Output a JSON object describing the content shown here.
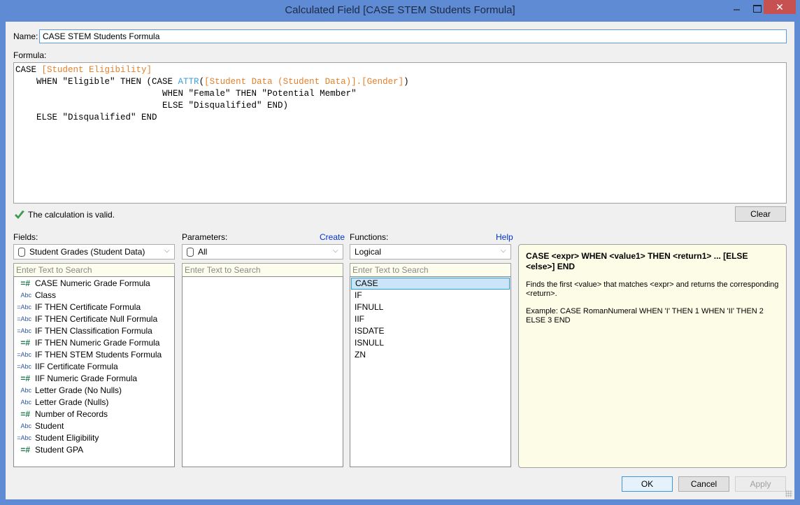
{
  "window": {
    "title": "Calculated Field [CASE STEM Students Formula]",
    "minimize_icon": "minimize-icon",
    "maximize_icon": "maximize-icon",
    "close_icon": "close-icon",
    "close_glyph": "✕"
  },
  "name": {
    "label": "Name:",
    "value": "CASE STEM Students Formula"
  },
  "formula": {
    "label": "Formula:",
    "lines": [
      [
        {
          "t": "kw",
          "v": "CASE "
        },
        {
          "t": "field",
          "v": "[Student Eligibility]"
        }
      ],
      [
        {
          "t": "kw",
          "v": "    WHEN \"Eligible\" THEN (CASE "
        },
        {
          "t": "func",
          "v": "ATTR"
        },
        {
          "t": "kw",
          "v": "("
        },
        {
          "t": "field",
          "v": "[Student Data (Student Data)].[Gender]"
        },
        {
          "t": "kw",
          "v": ")"
        }
      ],
      [
        {
          "t": "kw",
          "v": "                            WHEN \"Female\" THEN \"Potential Member\""
        }
      ],
      [
        {
          "t": "kw",
          "v": "                            ELSE \"Disqualified\" END)"
        }
      ],
      [
        {
          "t": "kw",
          "v": "    ELSE \"Disqualified\" END"
        }
      ]
    ]
  },
  "status": {
    "icon": "checkmark-icon",
    "text": "The calculation is valid.",
    "clear_label": "Clear"
  },
  "fields": {
    "label": "Fields:",
    "source": "Student Grades (Student Data)",
    "search_placeholder": "Enter Text to Search",
    "items": [
      {
        "type": "=#",
        "kind": "num",
        "label": "CASE Numeric Grade Formula"
      },
      {
        "type": "Abc",
        "kind": "str",
        "label": "Class"
      },
      {
        "type": "=Abc",
        "kind": "str",
        "label": "IF THEN Certificate Formula"
      },
      {
        "type": "=Abc",
        "kind": "str",
        "label": "IF THEN Certificate Null Formula"
      },
      {
        "type": "=Abc",
        "kind": "str",
        "label": "IF THEN Classification Formula"
      },
      {
        "type": "=#",
        "kind": "num",
        "label": "IF THEN Numeric Grade Formula"
      },
      {
        "type": "=Abc",
        "kind": "str",
        "label": "IF THEN STEM Students Formula"
      },
      {
        "type": "=Abc",
        "kind": "str",
        "label": "IIF Certificate Formula"
      },
      {
        "type": "=#",
        "kind": "num",
        "label": "IIF Numeric Grade Formula"
      },
      {
        "type": "Abc",
        "kind": "str",
        "label": "Letter Grade (No Nulls)"
      },
      {
        "type": "Abc",
        "kind": "str",
        "label": "Letter Grade (Nulls)"
      },
      {
        "type": "=#",
        "kind": "num",
        "label": "Number of Records"
      },
      {
        "type": "Abc",
        "kind": "str",
        "label": "Student"
      },
      {
        "type": "=Abc",
        "kind": "str",
        "label": "Student Eligibility"
      },
      {
        "type": "=#",
        "kind": "num",
        "label": "Student GPA"
      }
    ]
  },
  "parameters": {
    "label": "Parameters:",
    "create_label": "Create",
    "source": "All",
    "search_placeholder": "Enter Text to Search",
    "items": []
  },
  "functions": {
    "label": "Functions:",
    "help_label": "Help",
    "category": "Logical",
    "search_placeholder": "Enter Text to Search",
    "selected": "CASE",
    "items": [
      "CASE",
      "IF",
      "IFNULL",
      "IIF",
      "ISDATE",
      "ISNULL",
      "ZN"
    ]
  },
  "help": {
    "syntax": "CASE <expr> WHEN <value1> THEN <return1> ... [ELSE <else>] END",
    "description": "Finds the first <value> that matches <expr> and returns the corresponding <return>.",
    "example": "Example: CASE RomanNumeral WHEN 'I' THEN 1 WHEN 'II' THEN 2 ELSE 3 END"
  },
  "buttons": {
    "ok": "OK",
    "cancel": "Cancel",
    "apply": "Apply"
  },
  "colors": {
    "field_token": "#e5802a",
    "function_token": "#3d9fd6",
    "title_bar": "#5f8ad4",
    "close_button": "#c75050",
    "link": "#0033cc"
  }
}
